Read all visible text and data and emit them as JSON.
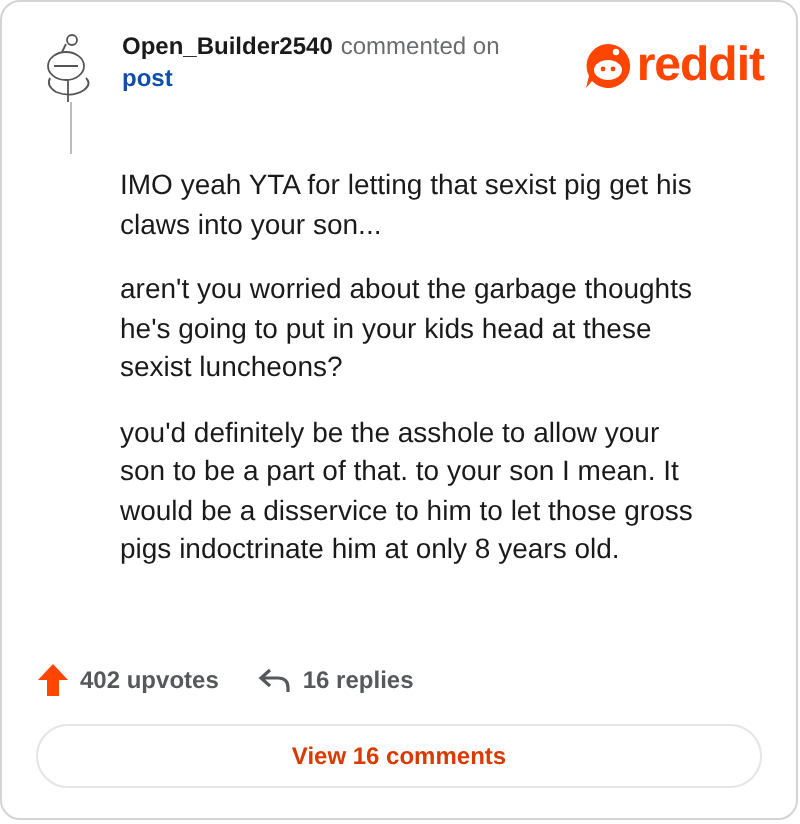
{
  "author": {
    "username": "Open_Builder2540",
    "action": "commented on",
    "target": "post"
  },
  "logo": {
    "wordmark": "reddit"
  },
  "paragraphs": [
    "IMO yeah YTA for letting that sexist pig get his claws into your son...",
    "aren't you worried about the garbage thoughts he's going to put in your kids head at these sexist luncheons?",
    "you'd definitely be the asshole to allow your son to be a part of that. to your son I mean. It would be a disservice to him to let those gross pigs indoctrinate him at only 8 years old."
  ],
  "stats": {
    "upvotes": "402 upvotes",
    "replies": "16 replies"
  },
  "button": {
    "label": "View 16 comments"
  }
}
